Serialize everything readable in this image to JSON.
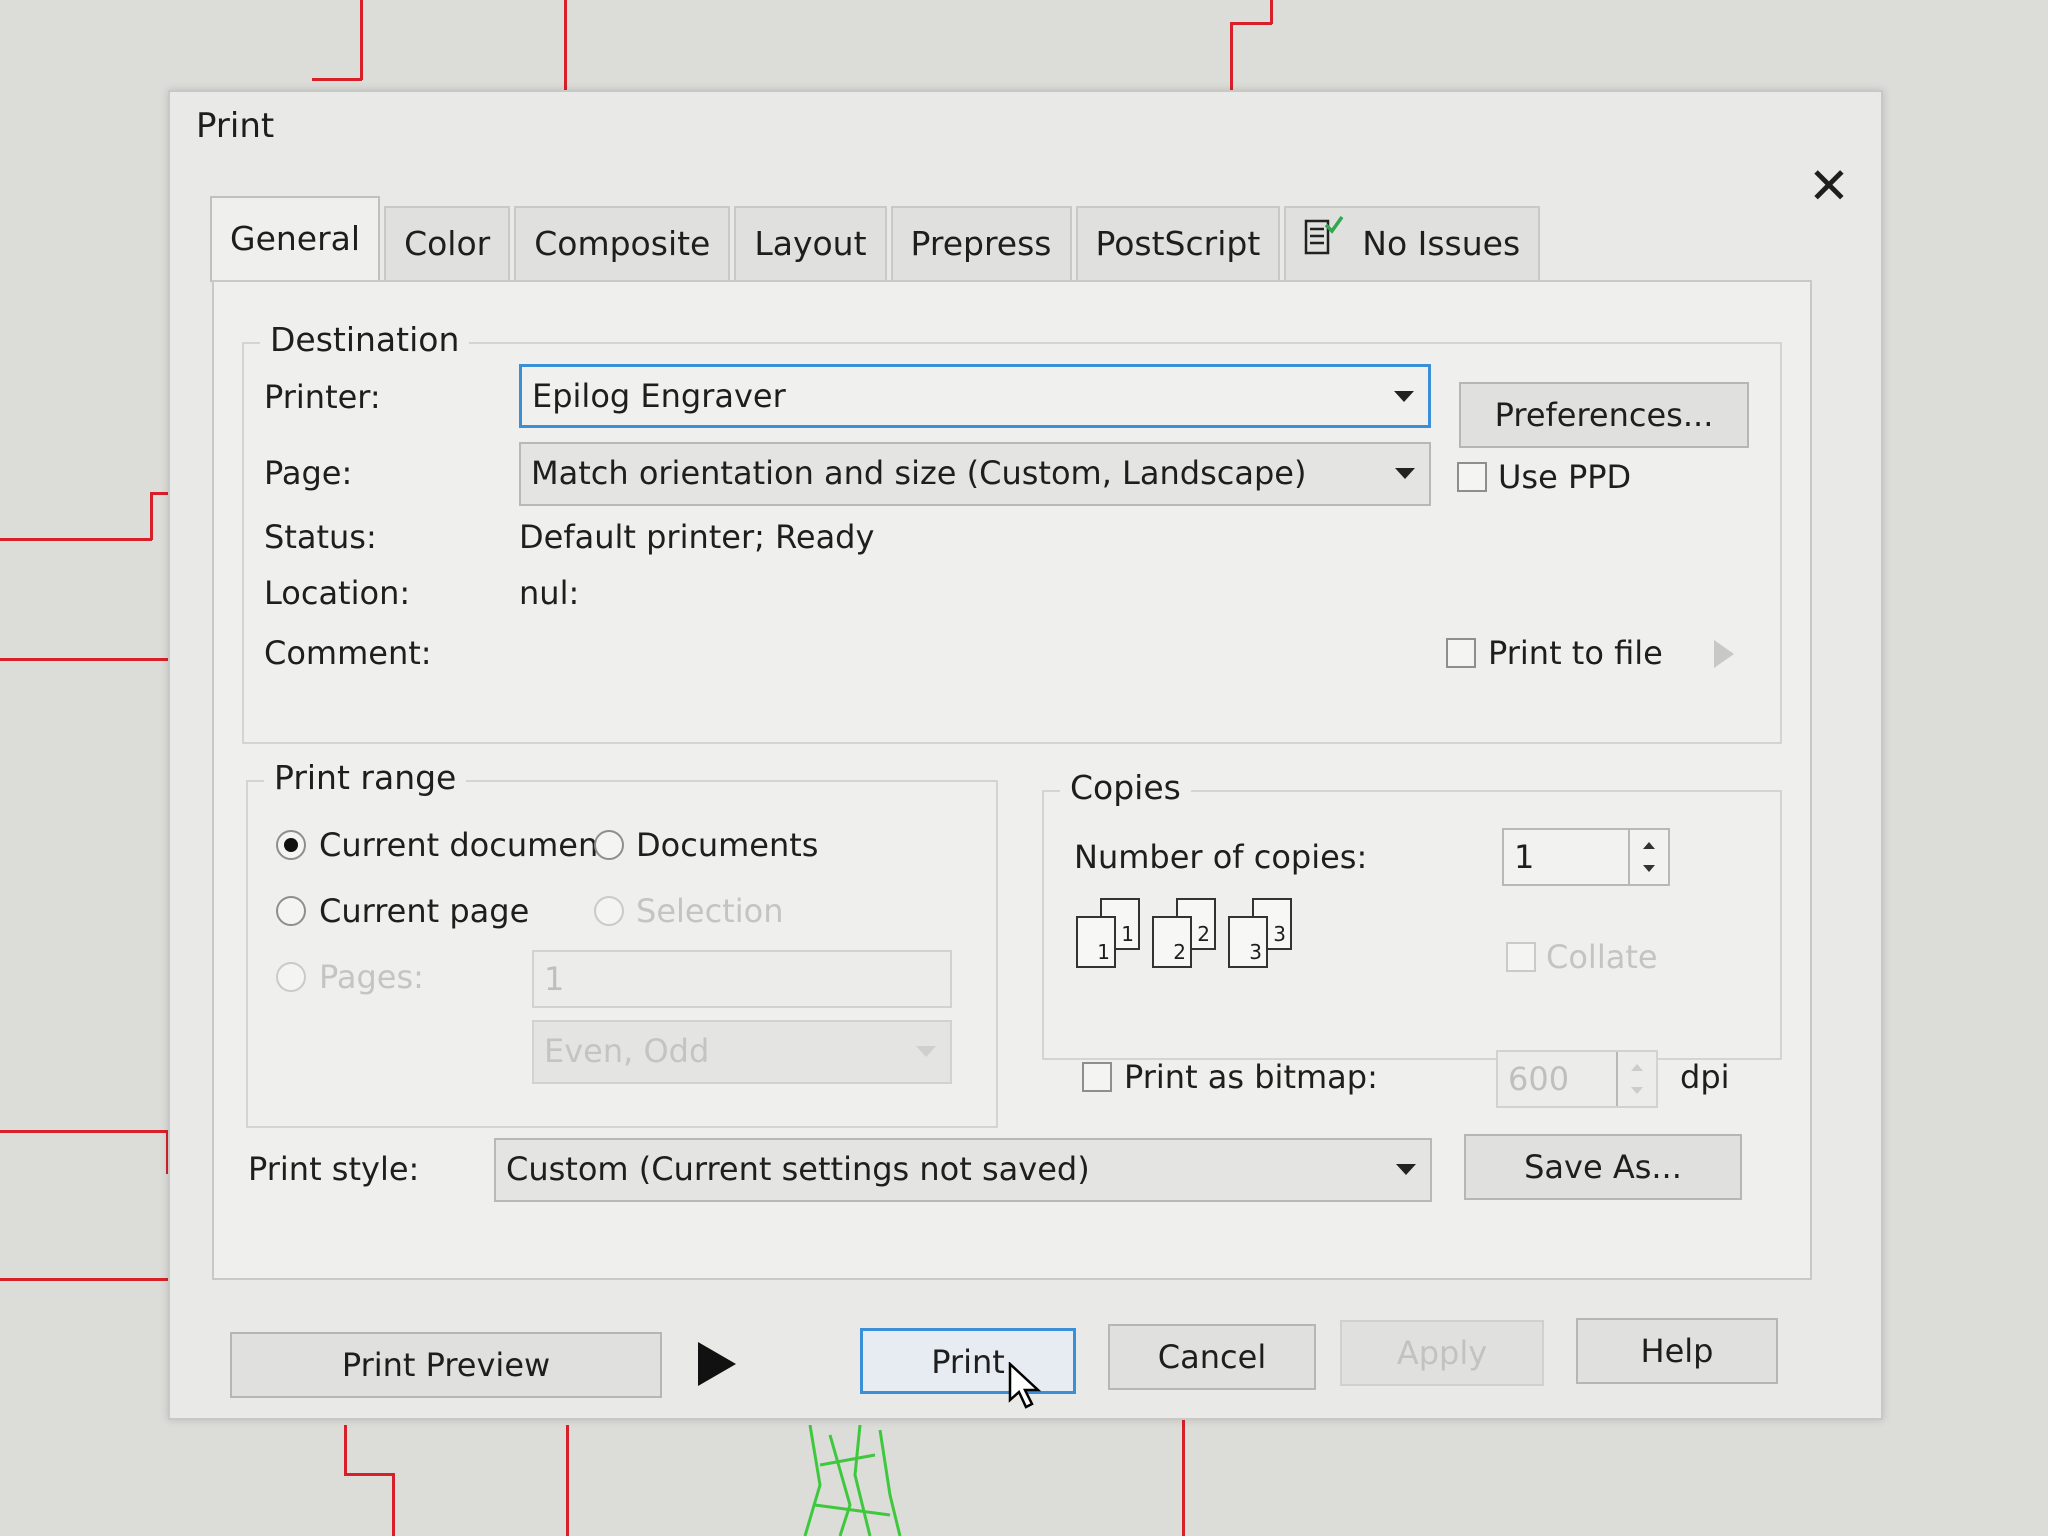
{
  "dialog": {
    "title": "Print",
    "close_icon": "close-icon"
  },
  "tabs": [
    {
      "label": "General",
      "active": true
    },
    {
      "label": "Color"
    },
    {
      "label": "Composite"
    },
    {
      "label": "Layout"
    },
    {
      "label": "Prepress"
    },
    {
      "label": "PostScript"
    },
    {
      "label": "No Issues",
      "icon": "checklist-icon"
    }
  ],
  "destination": {
    "legend": "Destination",
    "printer_label": "Printer:",
    "printer_value": "Epilog Engraver",
    "preferences_button": "Preferences...",
    "page_label": "Page:",
    "page_value": "Match orientation and size (Custom, Landscape)",
    "use_ppd_label": "Use PPD",
    "status_label": "Status:",
    "status_value": "Default printer; Ready",
    "location_label": "Location:",
    "location_value": "nul:",
    "comment_label": "Comment:",
    "print_to_file_label": "Print to file"
  },
  "print_range": {
    "legend": "Print range",
    "current_document": "Current document",
    "documents": "Documents",
    "current_page": "Current page",
    "selection": "Selection",
    "pages_label": "Pages:",
    "pages_value": "1",
    "even_odd_value": "Even, Odd"
  },
  "copies": {
    "legend": "Copies",
    "number_label": "Number of copies:",
    "number_value": "1",
    "collate_label": "Collate",
    "collate_pages": [
      "1",
      "1",
      "2",
      "2",
      "3",
      "3"
    ]
  },
  "bitmap": {
    "label": "Print as bitmap:",
    "dpi_value": "600",
    "dpi_unit": "dpi"
  },
  "print_style": {
    "label": "Print style:",
    "value": "Custom (Current settings not saved)",
    "save_as_button": "Save As..."
  },
  "footer": {
    "print_preview": "Print Preview",
    "print": "Print",
    "cancel": "Cancel",
    "apply": "Apply",
    "help": "Help"
  },
  "colors": {
    "focus_accent": "#3b8fd6",
    "background_lines": "#d8202a"
  }
}
